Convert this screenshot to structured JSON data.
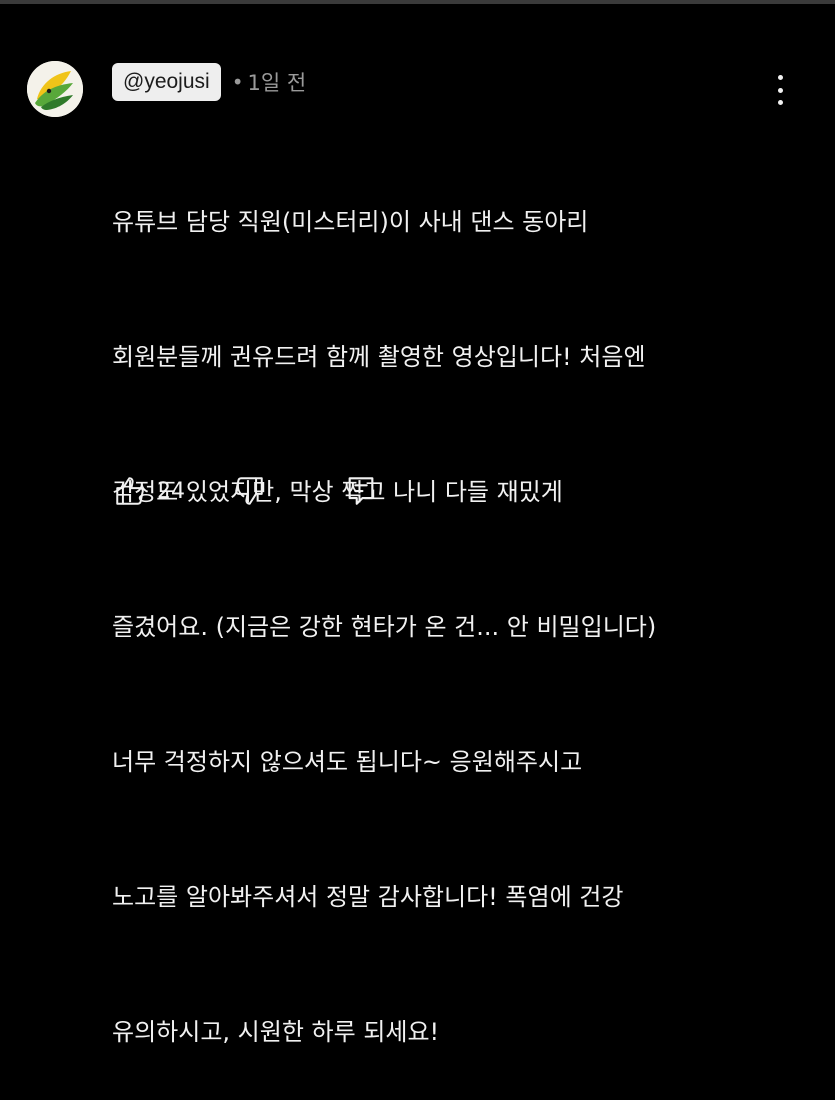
{
  "comment": {
    "author_handle": "@yeojusi",
    "separator": "•",
    "timestamp": "1일 전",
    "text_lines": [
      "유튜브 담당 직원(미스터리)이 사내 댄스 동아리",
      "회원분들께 권유드려 함께 촬영한 영상입니다! 처음엔",
      "걱정도 있었지만, 막상 찍고 나니 다들 재밌게",
      "즐겼어요. (지금은 강한 현타가 온 건... 안 비밀입니다)",
      "너무 걱정하지 않으셔도 됩니다~ 응원해주시고",
      "노고를 알아봐주셔서 정말 감사합니다! 폭염에 건강",
      "유의하시고, 시원한 하루 되세요!"
    ],
    "like_count": "24"
  },
  "icons": {
    "avatar": "avatar-logo",
    "more": "more-vertical-icon",
    "like": "thumbs-up-icon",
    "dislike": "thumbs-down-icon",
    "reply": "reply-comment-icon"
  },
  "colors": {
    "background": "#000000",
    "text": "#f1f1f1",
    "muted": "#9a9a9a",
    "handle_badge": "#eeeeee"
  }
}
